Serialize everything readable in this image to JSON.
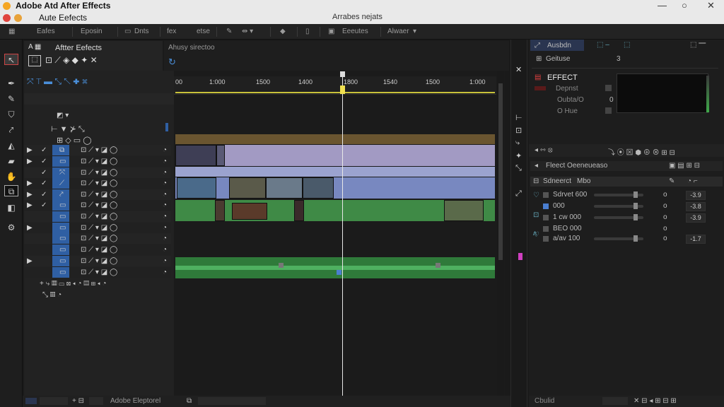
{
  "window": {
    "app_title": "Adobe Atd After Effects",
    "subtitle": "Aute Eefects",
    "title": "Arrabes nejats",
    "controls": [
      "—",
      "○",
      "✕"
    ]
  },
  "menubar": {
    "items": [
      "Eafes",
      "Eposin",
      "Dnts",
      "fex",
      "etse",
      "Eeeutes",
      "Alwaer"
    ]
  },
  "effects_panel": {
    "title": "Aftter Eefects",
    "comp_tab": "Ahusy sirectoo"
  },
  "timeline": {
    "ticks": [
      "00",
      "1:000",
      "1500",
      "1400",
      "1800",
      "1540",
      "1500",
      "1:000"
    ]
  },
  "right_panel": {
    "tab1": "Ausbdn",
    "tab2": "Geituse",
    "tab2_val": "3",
    "effect_title": "EFFECT",
    "effect_rows": [
      "Depnst",
      "Oubta/O",
      "O Hue"
    ],
    "effect_val": "0",
    "section_title": "Fleect Oeeneueaso",
    "props_header": "Sdneerct",
    "props_header2": "Mbo",
    "props": [
      {
        "label": "Sdrvet 600",
        "val": "o",
        "num": "-3.9"
      },
      {
        "label": "000",
        "val": "o",
        "num": "-3.8"
      },
      {
        "label": "1 cw 000",
        "val": "o",
        "num": "-3.9"
      },
      {
        "label": "BEO 000",
        "val": "o",
        "num": ""
      },
      {
        "label": "a/av 100",
        "val": "o",
        "num": "-1.7"
      }
    ],
    "status": "Cbulid"
  },
  "statusbar": {
    "label": "Adobe Eleptorel"
  },
  "colors": {
    "accent_blue": "#2f5fa3",
    "track_purple": "#9a7fb0",
    "track_lavender": "#a69bc7",
    "track_blue": "#7f8fc2",
    "track_green": "#3f8a46",
    "track_brown": "#6a5530"
  }
}
